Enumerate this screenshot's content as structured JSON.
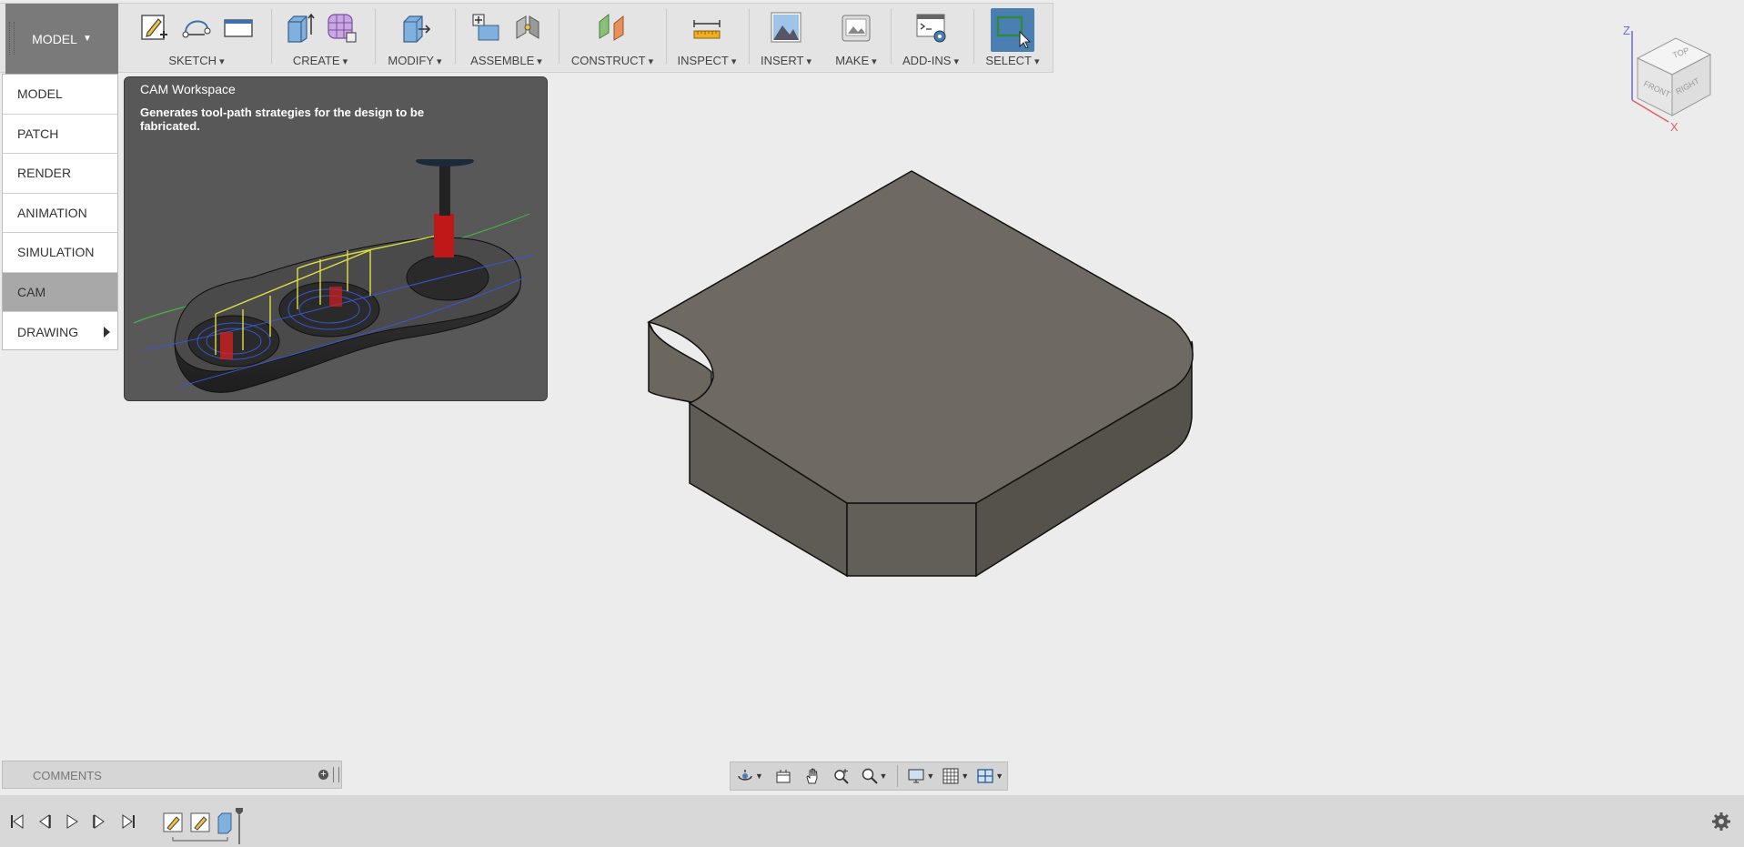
{
  "toolbar": {
    "workspace_label": "MODEL",
    "groups": [
      {
        "label": "SKETCH",
        "icons": [
          "sketch-icon",
          "line-arc-icon",
          "rectangle-icon"
        ]
      },
      {
        "label": "CREATE",
        "icons": [
          "extrude-icon",
          "form-icon"
        ]
      },
      {
        "label": "MODIFY",
        "icons": [
          "press-pull-icon"
        ]
      },
      {
        "label": "ASSEMBLE",
        "icons": [
          "new-component-icon",
          "joint-icon"
        ]
      },
      {
        "label": "CONSTRUCT",
        "icons": [
          "offset-plane-icon"
        ]
      },
      {
        "label": "INSPECT",
        "icons": [
          "measure-icon"
        ]
      },
      {
        "label": "INSERT",
        "icons": [
          "insert-image-icon"
        ]
      },
      {
        "label": "MAKE",
        "icons": [
          "3d-print-icon"
        ]
      },
      {
        "label": "ADD-INS",
        "icons": [
          "scripts-icon"
        ]
      },
      {
        "label": "SELECT",
        "icons": [
          "select-icon"
        ]
      }
    ]
  },
  "workspace_menu": {
    "items": [
      {
        "label": "MODEL",
        "active": false,
        "submenu": false
      },
      {
        "label": "PATCH",
        "active": false,
        "submenu": false
      },
      {
        "label": "RENDER",
        "active": false,
        "submenu": false
      },
      {
        "label": "ANIMATION",
        "active": false,
        "submenu": false
      },
      {
        "label": "SIMULATION",
        "active": false,
        "submenu": false
      },
      {
        "label": "CAM",
        "active": true,
        "submenu": false
      },
      {
        "label": "DRAWING",
        "active": false,
        "submenu": true
      }
    ]
  },
  "tooltip": {
    "title": "CAM Workspace",
    "description": "Generates tool-path strategies for the design to be fabricated."
  },
  "viewcube": {
    "faces": [
      "TOP",
      "FRONT",
      "RIGHT"
    ],
    "axes": [
      "Z",
      "X"
    ]
  },
  "comments": {
    "label": "COMMENTS"
  },
  "navbar": {
    "icons": [
      "orbit-icon",
      "look-at-icon",
      "pan-icon",
      "zoom-window-icon",
      "zoom-fit-icon",
      "display-settings-icon",
      "grid-icon",
      "viewports-icon"
    ]
  },
  "timeline": {
    "controls": [
      "skip-to-start-icon",
      "step-back-icon",
      "play-icon",
      "step-forward-icon",
      "skip-to-end-icon"
    ],
    "features": [
      "sketch-feature-icon",
      "sketch-feature-icon",
      "extrude-feature-icon"
    ]
  },
  "colors": {
    "background": "#ececec",
    "toolbar": "#e4e4e4",
    "workspace_button": "#7a7a7a",
    "select_accent": "#4a7fb3",
    "tooltip_bg": "#585858",
    "model_face": "#6e6a63"
  }
}
